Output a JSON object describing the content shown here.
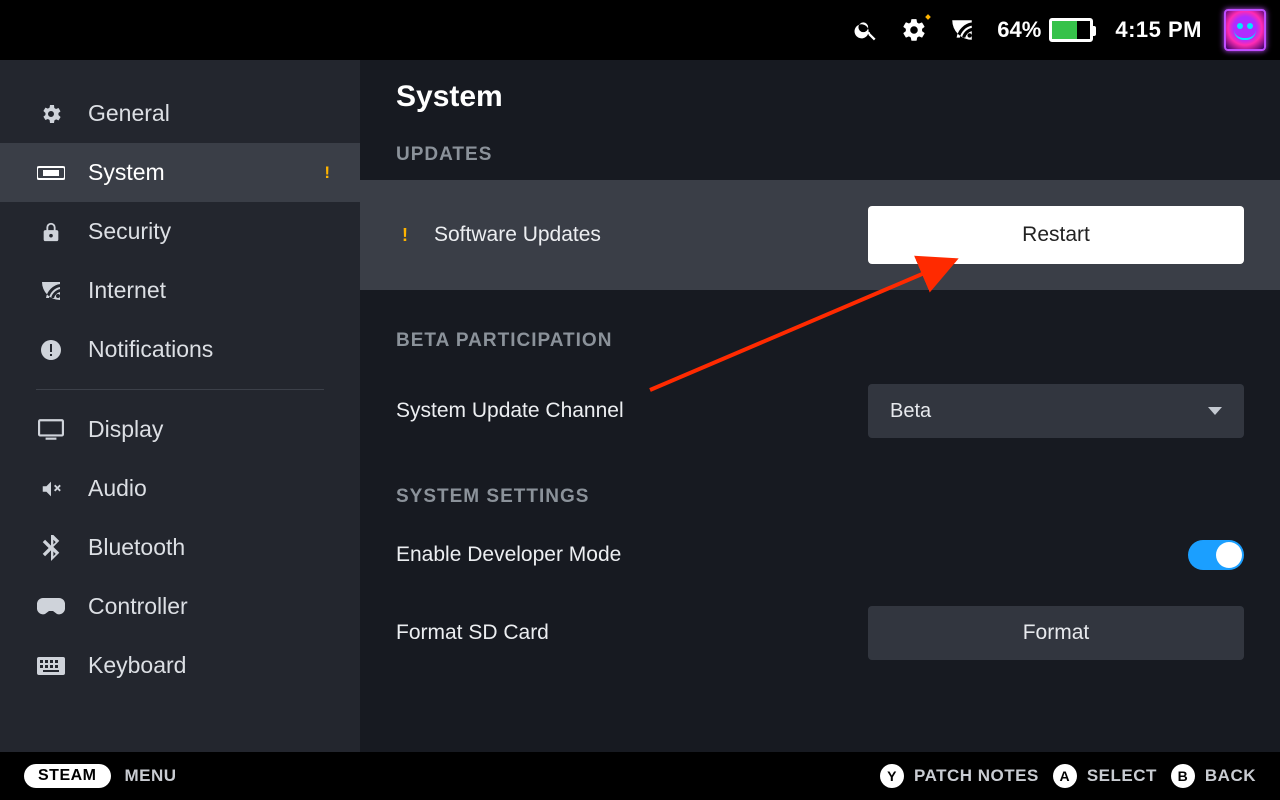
{
  "status": {
    "battery_pct": "64%",
    "time": "4:15 PM"
  },
  "sidebar": {
    "items": [
      {
        "label": "General"
      },
      {
        "label": "System"
      },
      {
        "label": "Security"
      },
      {
        "label": "Internet"
      },
      {
        "label": "Notifications"
      },
      {
        "label": "Display"
      },
      {
        "label": "Audio"
      },
      {
        "label": "Bluetooth"
      },
      {
        "label": "Controller"
      },
      {
        "label": "Keyboard"
      }
    ]
  },
  "page": {
    "title": "System",
    "sections": {
      "updates": {
        "title": "UPDATES",
        "software_updates_label": "Software Updates",
        "restart_label": "Restart"
      },
      "beta": {
        "title": "BETA PARTICIPATION",
        "channel_label": "System Update Channel",
        "channel_value": "Beta"
      },
      "settings": {
        "title": "SYSTEM SETTINGS",
        "devmode_label": "Enable Developer Mode",
        "devmode_on": true,
        "format_label": "Format SD Card",
        "format_button": "Format"
      }
    }
  },
  "footer": {
    "steam": "STEAM",
    "menu": "MENU",
    "y_label": "PATCH NOTES",
    "a_label": "SELECT",
    "b_label": "BACK"
  }
}
